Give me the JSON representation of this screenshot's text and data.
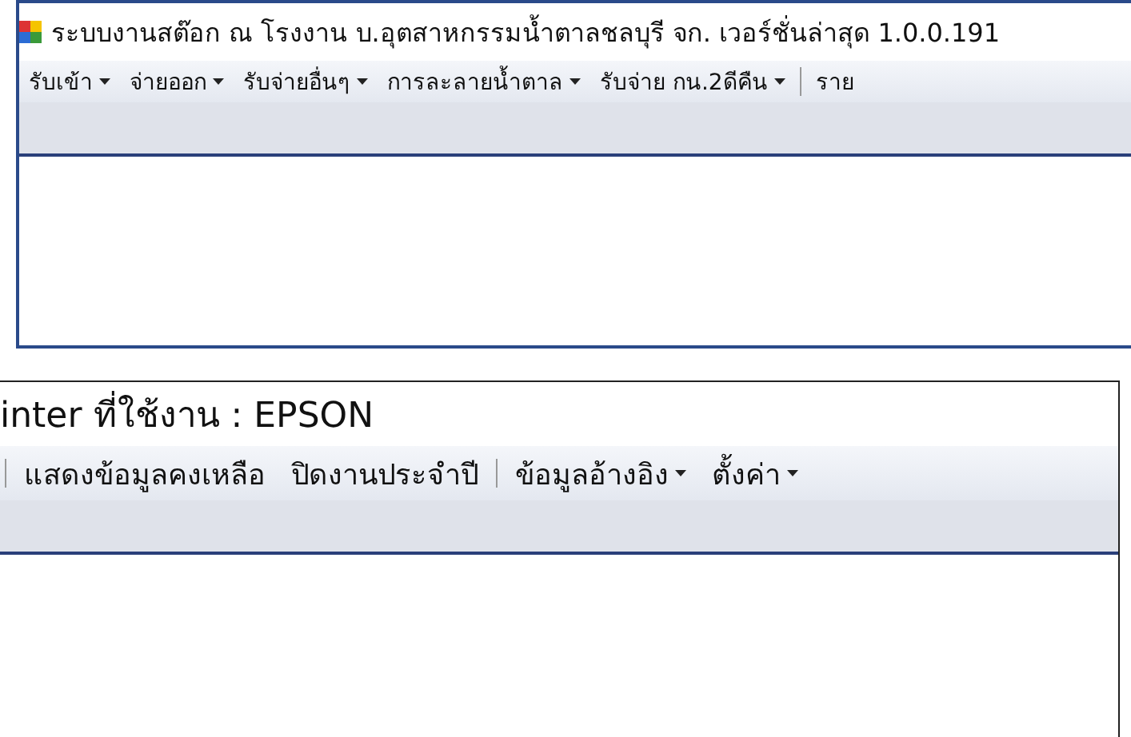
{
  "top_window": {
    "title": "ระบบงานสต๊อก ณ โรงงาน  บ.อุตสาหกรรมน้ำตาลชลบุรี จก.  เวอร์ชั่นล่าสุด 1.0.0.191",
    "menu": [
      {
        "kind": "item",
        "label": "รับเข้า",
        "dropdown": true
      },
      {
        "kind": "item",
        "label": "จ่ายออก",
        "dropdown": true
      },
      {
        "kind": "item",
        "label": "รับจ่ายอื่นๆ",
        "dropdown": true
      },
      {
        "kind": "item",
        "label": "การละลายน้ำตาล",
        "dropdown": true
      },
      {
        "kind": "item",
        "label": "รับจ่าย กน.2ดีคืน",
        "dropdown": true
      },
      {
        "kind": "separator"
      },
      {
        "kind": "item",
        "label": "ราย",
        "dropdown": false
      }
    ]
  },
  "bottom_window": {
    "title": "inter ที่ใช้งาน  : EPSON",
    "menu": [
      {
        "kind": "separator"
      },
      {
        "kind": "item",
        "label": "แสดงข้อมูลคงเหลือ",
        "dropdown": false
      },
      {
        "kind": "item",
        "label": "ปิดงานประจำปี",
        "dropdown": false
      },
      {
        "kind": "separator"
      },
      {
        "kind": "item",
        "label": "ข้อมูลอ้างอิง",
        "dropdown": true
      },
      {
        "kind": "item",
        "label": "ตั้งค่า",
        "dropdown": true
      }
    ]
  }
}
